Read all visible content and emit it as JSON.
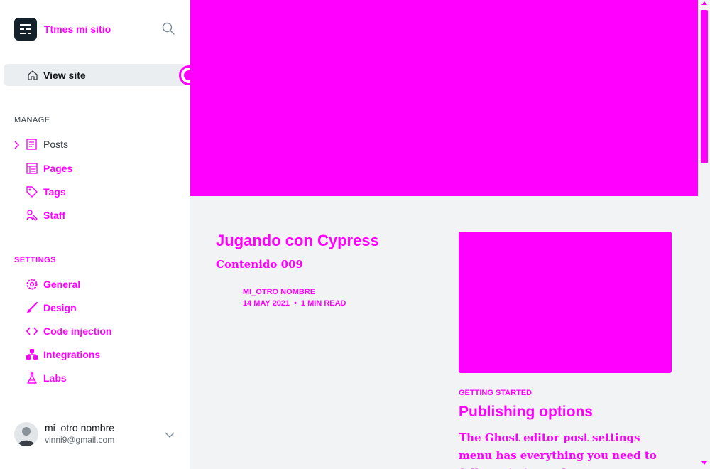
{
  "sidebar": {
    "site_title": "Ttmes mi sitio",
    "view_site": "View site",
    "manage_heading": "MANAGE",
    "settings_heading": "SETTINGS",
    "manage_items": [
      {
        "label": "Posts",
        "icon": "posts-icon"
      },
      {
        "label": "Pages",
        "icon": "pages-icon"
      },
      {
        "label": "Tags",
        "icon": "tag-icon"
      },
      {
        "label": "Staff",
        "icon": "staff-icon"
      }
    ],
    "settings_items": [
      {
        "label": "General",
        "icon": "gear-icon"
      },
      {
        "label": "Design",
        "icon": "brush-icon"
      },
      {
        "label": "Code injection",
        "icon": "code-icon"
      },
      {
        "label": "Integrations",
        "icon": "integrations-icon"
      },
      {
        "label": "Labs",
        "icon": "flask-icon"
      }
    ],
    "user": {
      "name": "mi_otro nombre",
      "email": "vinni9@gmail.com"
    }
  },
  "main": {
    "post": {
      "title": "Jugando con Cypress",
      "subtitle": "Contenido 009",
      "author": "MI_OTRO NOMBRE",
      "date": "14 MAY 2021",
      "read_time": "1 MIN READ",
      "separator": "•"
    },
    "card": {
      "tag": "GETTING STARTED",
      "title": "Publishing options",
      "excerpt": "The Ghost editor post settings menu has everything you need to fully optimise and"
    }
  },
  "colors": {
    "accent": "#ff00ff",
    "sidebar_bg": "#ffffff",
    "main_bg": "#f1f3f4",
    "logo_bg": "#15212a"
  }
}
